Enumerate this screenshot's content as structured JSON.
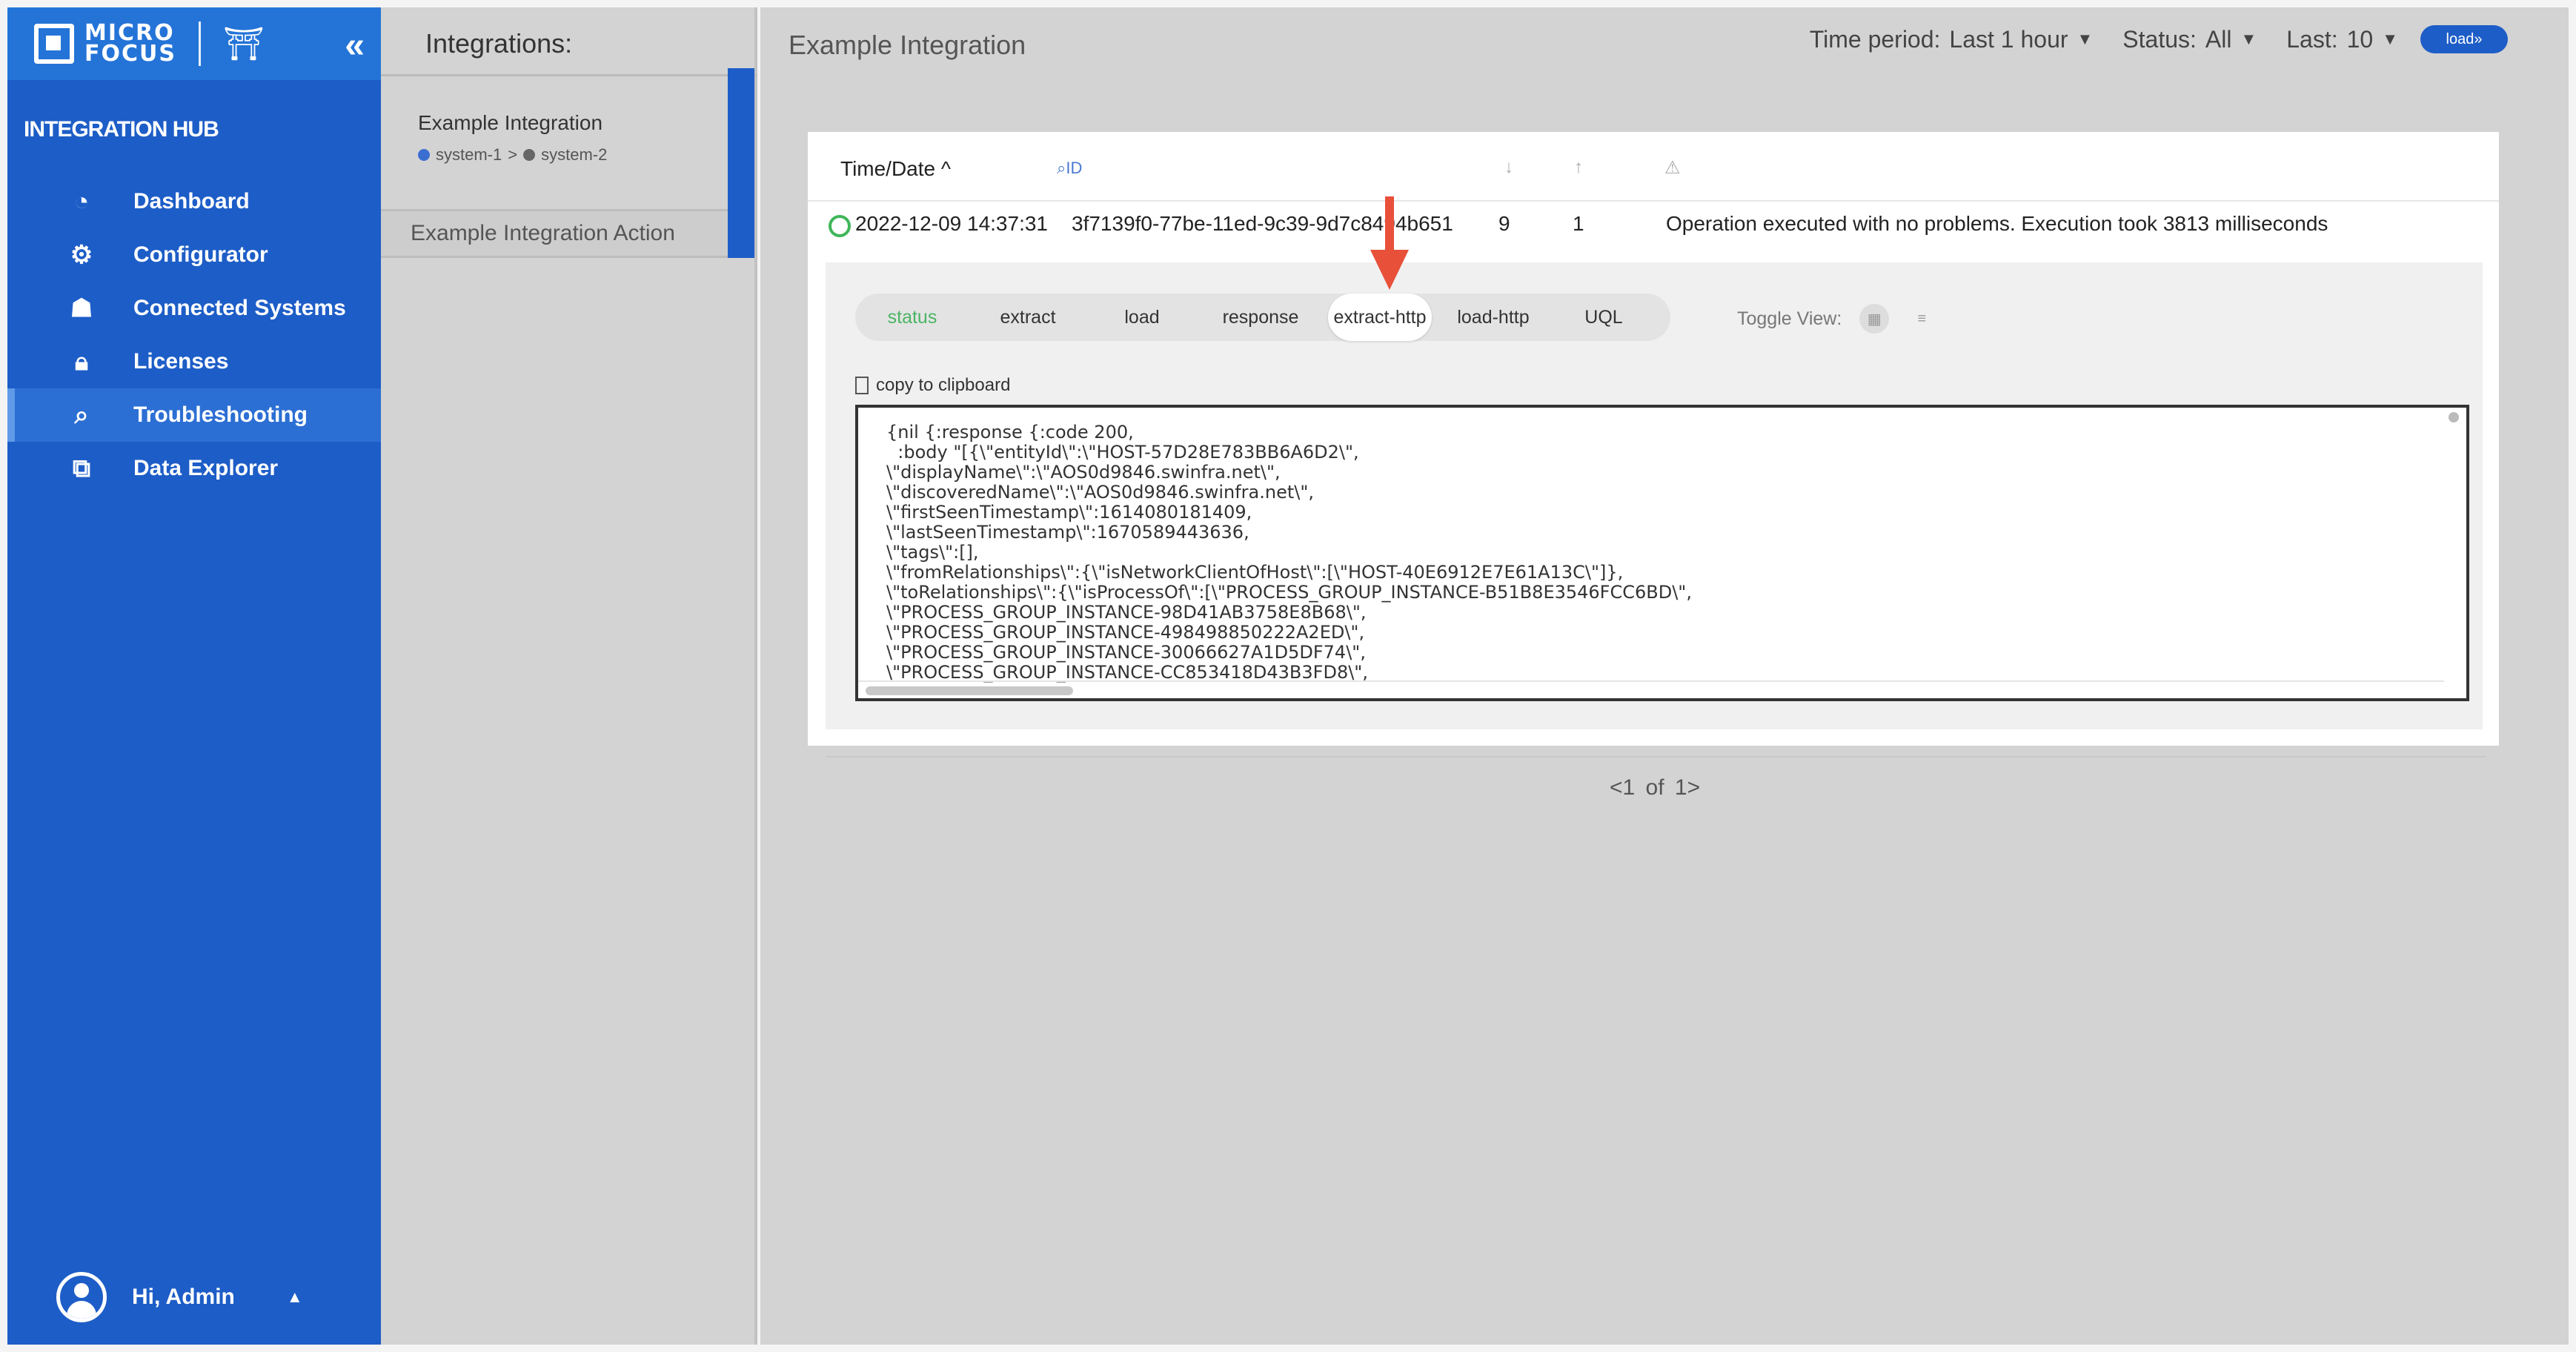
{
  "sidebar": {
    "logo_line1": "MICRO",
    "logo_line2": "FOCUS",
    "collapse_icon": "«",
    "title": "INTEGRATION HUB",
    "items": [
      {
        "label": "Dashboard",
        "icon": "dashboard-icon"
      },
      {
        "label": "Configurator",
        "icon": "gear-icon"
      },
      {
        "label": "Connected Systems",
        "icon": "network-icon"
      },
      {
        "label": "Licenses",
        "icon": "lock-icon"
      },
      {
        "label": "Troubleshooting",
        "icon": "search-icon",
        "active": true
      },
      {
        "label": "Data Explorer",
        "icon": "data-explorer-icon"
      }
    ],
    "user_label": "Hi, Admin"
  },
  "integrations": {
    "title": "Integrations:",
    "item_name": "Example Integration",
    "source": "system-1",
    "path_sep": ">",
    "target": "system-2",
    "action": "Example Integration Action"
  },
  "main": {
    "title": "Example Integration",
    "filters": {
      "time_label": "Time period:",
      "time_value": "Last 1 hour",
      "status_label": "Status:",
      "status_value": "All",
      "last_label": "Last:",
      "last_value": "10",
      "load_label": "load»"
    },
    "table": {
      "time_header": "Time/Date ^",
      "id_header": "ID",
      "row": {
        "time": "2022-12-09 14:37:31",
        "id": "3f7139f0-77be-11ed-9c39-9d7c8494b651",
        "down": "9",
        "up": "1",
        "message": "Operation executed with no problems. Execution took 3813 milliseconds"
      }
    },
    "tabs": [
      "status",
      "extract",
      "load",
      "response",
      "extract-http",
      "load-http",
      "UQL"
    ],
    "toggle_label": "Toggle View:",
    "copy_label": "copy to clipboard",
    "code": "{nil {:response {:code 200,\n  :body \"[{\\\"entityId\\\":\\\"HOST-57D28E783BB6A6D2\\\",\n\\\"displayName\\\":\\\"AOS0d9846.swinfra.net\\\",\n\\\"discoveredName\\\":\\\"AOS0d9846.swinfra.net\\\",\n\\\"firstSeenTimestamp\\\":1614080181409,\n\\\"lastSeenTimestamp\\\":1670589443636,\n\\\"tags\\\":[],\n\\\"fromRelationships\\\":{\\\"isNetworkClientOfHost\\\":[\\\"HOST-40E6912E7E61A13C\\\"]},\n\\\"toRelationships\\\":{\\\"isProcessOf\\\":[\\\"PROCESS_GROUP_INSTANCE-B51B8E3546FCC6BD\\\",\n\\\"PROCESS_GROUP_INSTANCE-98D41AB3758E8B68\\\",\n\\\"PROCESS_GROUP_INSTANCE-498498850222A2ED\\\",\n\\\"PROCESS_GROUP_INSTANCE-30066627A1D5DF74\\\",\n\\\"PROCESS_GROUP_INSTANCE-CC853418D43B3FD8\\\",",
    "pager": "<1 of 1>"
  },
  "colors": {
    "sidebar": "#1d5dc7",
    "accent": "#2474d8",
    "ok": "#3fb659",
    "annotation": "#e8503a"
  }
}
